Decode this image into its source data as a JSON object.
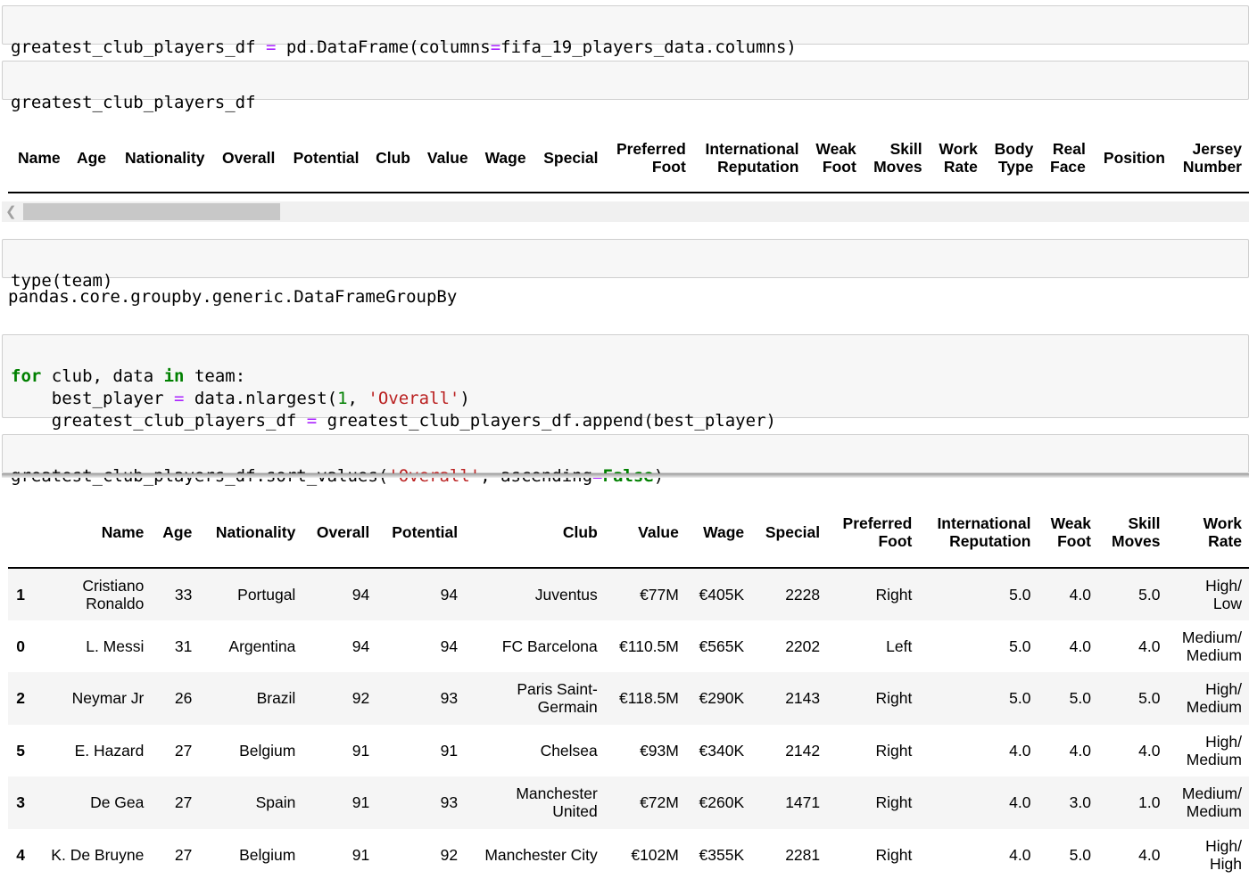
{
  "cells": {
    "cell1": {
      "lhs": "greatest_club_players_df",
      "eq": "=",
      "call": "pd.DataFrame(columns",
      "eq2": "=",
      "arg": "fifa_19_players_data.columns)"
    },
    "cell2": {
      "code": "greatest_club_players_df"
    },
    "cell3": {
      "code": "type(team)",
      "output": "pandas.core.groupby.generic.DataFrameGroupBy"
    },
    "cell4": {
      "kw_for": "for",
      "loop_vars": " club, data ",
      "kw_in": "in",
      "loop_iter": " team:",
      "l2_a": "    best_player ",
      "l2_eq": "=",
      "l2_b": " data.nlargest(",
      "l2_num": "1",
      "l2_c": ", ",
      "l2_str": "'Overall'",
      "l2_d": ")",
      "l3_a": "    greatest_club_players_df ",
      "l3_eq": "=",
      "l3_b": " greatest_club_players_df.append(best_player)"
    },
    "cell5": {
      "a": "greatest_club_players_df.sort_values(",
      "str": "'Overall'",
      "b": ", ascending",
      "eq": "=",
      "kw": "False",
      "c": ")"
    }
  },
  "empty_table": {
    "headers": [
      [
        "Name"
      ],
      [
        "Age"
      ],
      [
        "Nationality"
      ],
      [
        "Overall"
      ],
      [
        "Potential"
      ],
      [
        "Club"
      ],
      [
        "Value"
      ],
      [
        "Wage"
      ],
      [
        "Special"
      ],
      [
        "Preferred",
        "Foot"
      ],
      [
        "International",
        "Reputation"
      ],
      [
        "Weak",
        "Foot"
      ],
      [
        "Skill",
        "Moves"
      ],
      [
        "Work",
        "Rate"
      ],
      [
        "Body",
        "Type"
      ],
      [
        "Real",
        "Face"
      ],
      [
        "Position"
      ],
      [
        "Jersey",
        "Number"
      ]
    ]
  },
  "result_table": {
    "headers": [
      [
        ""
      ],
      [
        "Name"
      ],
      [
        "Age"
      ],
      [
        "Nationality"
      ],
      [
        "Overall"
      ],
      [
        "Potential"
      ],
      [
        "Club"
      ],
      [
        "Value"
      ],
      [
        "Wage"
      ],
      [
        "Special"
      ],
      [
        "Preferred",
        "Foot"
      ],
      [
        "International",
        "Reputation"
      ],
      [
        "Weak",
        "Foot"
      ],
      [
        "Skill",
        "Moves"
      ],
      [
        "Work",
        "Rate"
      ]
    ],
    "rows": [
      [
        [
          "1"
        ],
        [
          "Cristiano",
          "Ronaldo"
        ],
        [
          "33"
        ],
        [
          "Portugal"
        ],
        [
          "94"
        ],
        [
          "94"
        ],
        [
          "Juventus"
        ],
        [
          "€77M"
        ],
        [
          "€405K"
        ],
        [
          "2228"
        ],
        [
          "Right"
        ],
        [
          "5.0"
        ],
        [
          "4.0"
        ],
        [
          "5.0"
        ],
        [
          "High/",
          "Low"
        ]
      ],
      [
        [
          "0"
        ],
        [
          "L. Messi"
        ],
        [
          "31"
        ],
        [
          "Argentina"
        ],
        [
          "94"
        ],
        [
          "94"
        ],
        [
          "FC Barcelona"
        ],
        [
          "€110.5M"
        ],
        [
          "€565K"
        ],
        [
          "2202"
        ],
        [
          "Left"
        ],
        [
          "5.0"
        ],
        [
          "4.0"
        ],
        [
          "4.0"
        ],
        [
          "Medium/",
          "Medium"
        ]
      ],
      [
        [
          "2"
        ],
        [
          "Neymar Jr"
        ],
        [
          "26"
        ],
        [
          "Brazil"
        ],
        [
          "92"
        ],
        [
          "93"
        ],
        [
          "Paris Saint-",
          "Germain"
        ],
        [
          "€118.5M"
        ],
        [
          "€290K"
        ],
        [
          "2143"
        ],
        [
          "Right"
        ],
        [
          "5.0"
        ],
        [
          "5.0"
        ],
        [
          "5.0"
        ],
        [
          "High/",
          "Medium"
        ]
      ],
      [
        [
          "5"
        ],
        [
          "E. Hazard"
        ],
        [
          "27"
        ],
        [
          "Belgium"
        ],
        [
          "91"
        ],
        [
          "91"
        ],
        [
          "Chelsea"
        ],
        [
          "€93M"
        ],
        [
          "€340K"
        ],
        [
          "2142"
        ],
        [
          "Right"
        ],
        [
          "4.0"
        ],
        [
          "4.0"
        ],
        [
          "4.0"
        ],
        [
          "High/",
          "Medium"
        ]
      ],
      [
        [
          "3"
        ],
        [
          "De Gea"
        ],
        [
          "27"
        ],
        [
          "Spain"
        ],
        [
          "91"
        ],
        [
          "93"
        ],
        [
          "Manchester",
          "United"
        ],
        [
          "€72M"
        ],
        [
          "€260K"
        ],
        [
          "1471"
        ],
        [
          "Right"
        ],
        [
          "4.0"
        ],
        [
          "3.0"
        ],
        [
          "1.0"
        ],
        [
          "Medium/",
          "Medium"
        ]
      ],
      [
        [
          "4"
        ],
        [
          "K. De Bruyne"
        ],
        [
          "27"
        ],
        [
          "Belgium"
        ],
        [
          "91"
        ],
        [
          "92"
        ],
        [
          "Manchester City"
        ],
        [
          "€102M"
        ],
        [
          "€355K"
        ],
        [
          "2281"
        ],
        [
          "Right"
        ],
        [
          "4.0"
        ],
        [
          "5.0"
        ],
        [
          "4.0"
        ],
        [
          "High/",
          "High"
        ]
      ]
    ]
  }
}
